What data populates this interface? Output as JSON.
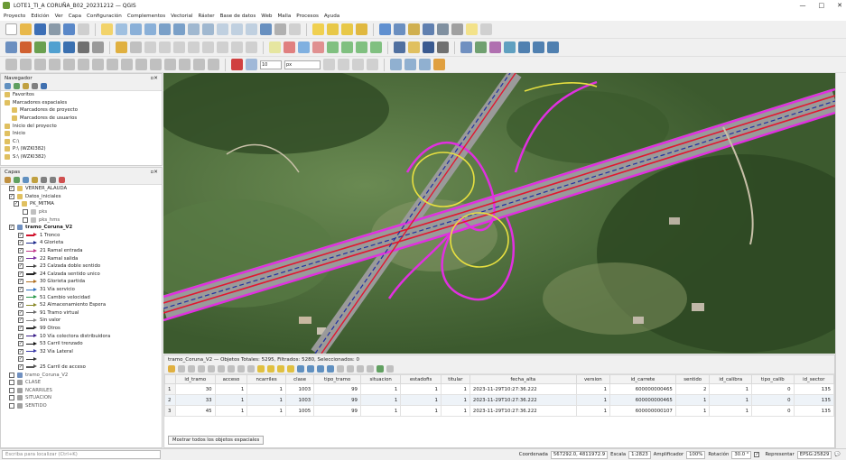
{
  "window": {
    "title": "LOTE1_TI_A CORUÑA_B02_20231212 — QGIS",
    "minimize": "—",
    "maximize": "□",
    "close": "✕"
  },
  "menu": [
    "Proyecto",
    "Edición",
    "Ver",
    "Capa",
    "Configuración",
    "Complementos",
    "Vectorial",
    "Ráster",
    "Base de datos",
    "Web",
    "Malla",
    "Procesos",
    "Ayuda"
  ],
  "toolbar": {
    "snap_tolerance": "10",
    "snap_unit": "px"
  },
  "navigator": {
    "title": "Navegador",
    "items": [
      {
        "label": "Favoritos",
        "indent": 0
      },
      {
        "label": "Marcadores espaciales",
        "indent": 0
      },
      {
        "label": "Marcadores de proyecto",
        "indent": 2
      },
      {
        "label": "Marcadores de usuarios",
        "indent": 2
      },
      {
        "label": "Inicio del proyecto",
        "indent": 0
      },
      {
        "label": "Inicio",
        "indent": 0
      },
      {
        "label": "C:\\",
        "indent": 0
      },
      {
        "label": "P:\\ (WZKI382)",
        "indent": 0
      },
      {
        "label": "S:\\ (WZKI382)",
        "indent": 0
      }
    ]
  },
  "layers": {
    "title": "Capas",
    "items": [
      {
        "label": "VERNER_ALAUDA",
        "indent": 1,
        "checked": true,
        "symbol": "group"
      },
      {
        "label": "Datos_iniciales",
        "indent": 1,
        "checked": true,
        "symbol": "group"
      },
      {
        "label": "PK_MITMA",
        "indent": 2,
        "checked": true,
        "symbol": "group"
      },
      {
        "label": "pks",
        "indent": 4,
        "checked": false,
        "symbol": "point"
      },
      {
        "label": "pks_hms",
        "indent": 4,
        "checked": false,
        "symbol": "point"
      },
      {
        "label": "tramo_Coruna_V2",
        "indent": 1,
        "checked": true,
        "symbol": "line",
        "bold": true
      },
      {
        "label": "1 Tronco",
        "indent": 3,
        "checked": true,
        "symbol": "arrow",
        "color": "#d0102a"
      },
      {
        "label": "4 Glorieta",
        "indent": 3,
        "checked": true,
        "symbol": "arrow",
        "color": "#1e2a8c"
      },
      {
        "label": "21 Ramal entrada",
        "indent": 3,
        "checked": true,
        "symbol": "arrow",
        "color": "#c23a8a"
      },
      {
        "label": "22 Ramal salida",
        "indent": 3,
        "checked": true,
        "symbol": "arrow",
        "color": "#7a2da0"
      },
      {
        "label": "23 Calzada doble sentido",
        "indent": 3,
        "checked": true,
        "symbol": "arrow",
        "color": "#444444"
      },
      {
        "label": "24 Calzada sentido unico",
        "indent": 3,
        "checked": true,
        "symbol": "arrow",
        "color": "#222222"
      },
      {
        "label": "30 Glorieta partida",
        "indent": 3,
        "checked": true,
        "symbol": "arrow",
        "color": "#b07020"
      },
      {
        "label": "31 Vía servicio",
        "indent": 3,
        "checked": true,
        "symbol": "arrow",
        "color": "#2e6fbf"
      },
      {
        "label": "51 Cambio velocidad",
        "indent": 3,
        "checked": true,
        "symbol": "arrow",
        "color": "#2a9a4a"
      },
      {
        "label": "52 Almacenamiento Espera",
        "indent": 3,
        "checked": true,
        "symbol": "arrow",
        "color": "#8a8a2a"
      },
      {
        "label": "91 Tramo virtual",
        "indent": 3,
        "checked": true,
        "symbol": "arrow",
        "color": "#6a6a6a"
      },
      {
        "label": "Sin valor",
        "indent": 3,
        "checked": true,
        "symbol": "arrow",
        "color": "#888888"
      },
      {
        "label": "99 Otros",
        "indent": 3,
        "checked": true,
        "symbol": "arrow",
        "color": "#333333"
      },
      {
        "label": "10 Vía colectora distribuidora",
        "indent": 3,
        "checked": true,
        "symbol": "arrow",
        "color": "#3b1f8a"
      },
      {
        "label": "53 Carril trenzado",
        "indent": 3,
        "checked": true,
        "symbol": "arrow",
        "color": "#111111"
      },
      {
        "label": "32 Vía Lateral",
        "indent": 3,
        "checked": true,
        "symbol": "arrow",
        "color": "#3a3aa8"
      },
      {
        "label": "",
        "indent": 3,
        "checked": true,
        "symbol": "arrow",
        "color": "#333333"
      },
      {
        "label": "25 Carril de acceso",
        "indent": 3,
        "checked": true,
        "symbol": "arrow",
        "color": "#555555"
      },
      {
        "label": "tramo_Coruna_V2",
        "indent": 1,
        "checked": false,
        "symbol": "line"
      },
      {
        "label": "CLASE",
        "indent": 1,
        "checked": false,
        "symbol": "table"
      },
      {
        "label": "NCARRILES",
        "indent": 1,
        "checked": false,
        "symbol": "table"
      },
      {
        "label": "SITUACION",
        "indent": 1,
        "checked": false,
        "symbol": "table"
      },
      {
        "label": "SENTIDO",
        "indent": 1,
        "checked": false,
        "symbol": "table"
      }
    ]
  },
  "attribute_table": {
    "title": "tramo_Coruna_V2 — Objetos Totales: 5295, Filtrados: 5280, Seleccionados: 0",
    "columns": [
      "id_tramo",
      "acceso",
      "ncarriles",
      "clase",
      "tipo_tramo",
      "situacion",
      "estadofis",
      "titular",
      "fecha_alta",
      "version",
      "id_carrete",
      "sentido",
      "id_calibra",
      "tipo_calib",
      "id_sector"
    ],
    "rows": [
      {
        "n": "1",
        "cells": [
          "30",
          "1",
          "1",
          "1003",
          "99",
          "1",
          "1",
          "1",
          "2023-11-29T10:27:36.222",
          "1",
          "600000000465",
          "2",
          "1",
          "0",
          "135"
        ]
      },
      {
        "n": "2",
        "cells": [
          "33",
          "1",
          "1",
          "1003",
          "99",
          "1",
          "1",
          "1",
          "2023-11-29T10:27:36.222",
          "1",
          "600000000465",
          "1",
          "1",
          "0",
          "135"
        ]
      },
      {
        "n": "3",
        "cells": [
          "45",
          "1",
          "1",
          "1005",
          "99",
          "1",
          "1",
          "1",
          "2023-11-29T10:27:36.222",
          "1",
          "600000000107",
          "1",
          "1",
          "0",
          "135"
        ]
      }
    ],
    "show_all_button": "Mostrar todos los objetos espaciales"
  },
  "statusbar": {
    "locator_placeholder": "Escriba para localizar (Ctrl+K)",
    "coord_label": "Coordenada",
    "coord_value": "567292.0, 4811972.9",
    "scale_label": "Escala",
    "scale_value": "1:2823",
    "magnifier_label": "Amplificador",
    "magnifier_value": "100%",
    "rotation_label": "Rotación",
    "rotation_value": "30.0 °",
    "render_label": "Representar",
    "crs": "EPSG:25829"
  }
}
